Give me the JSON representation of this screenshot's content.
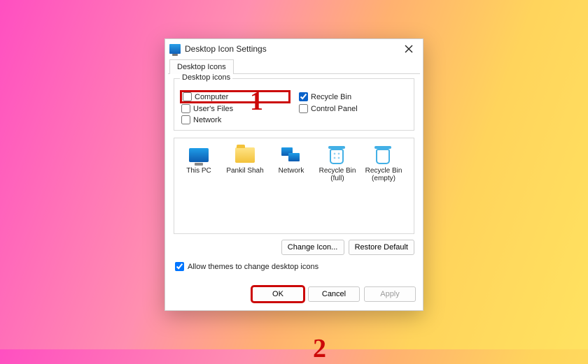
{
  "window": {
    "title": "Desktop Icon Settings"
  },
  "tab": {
    "label": "Desktop Icons"
  },
  "fieldset": {
    "legend": "Desktop icons",
    "items": {
      "computer": {
        "label": "Computer",
        "checked": false
      },
      "recycle_bin": {
        "label": "Recycle Bin",
        "checked": true
      },
      "users_files": {
        "label": "User's Files",
        "checked": false
      },
      "control_panel": {
        "label": "Control Panel",
        "checked": false
      },
      "network": {
        "label": "Network",
        "checked": false
      }
    }
  },
  "preview_icons": [
    {
      "label": "This PC",
      "icon": "pc"
    },
    {
      "label": "Pankil Shah",
      "icon": "folder"
    },
    {
      "label": "Network",
      "icon": "network"
    },
    {
      "label": "Recycle Bin (full)",
      "icon": "bin-full"
    },
    {
      "label": "Recycle Bin (empty)",
      "icon": "bin-empty"
    }
  ],
  "buttons": {
    "change_icon": "Change Icon...",
    "restore_default": "Restore Default",
    "ok": "OK",
    "cancel": "Cancel",
    "apply": "Apply"
  },
  "allow_themes": {
    "label": "Allow themes to change desktop icons",
    "checked": true
  },
  "annotations": {
    "one": "1",
    "two": "2"
  }
}
